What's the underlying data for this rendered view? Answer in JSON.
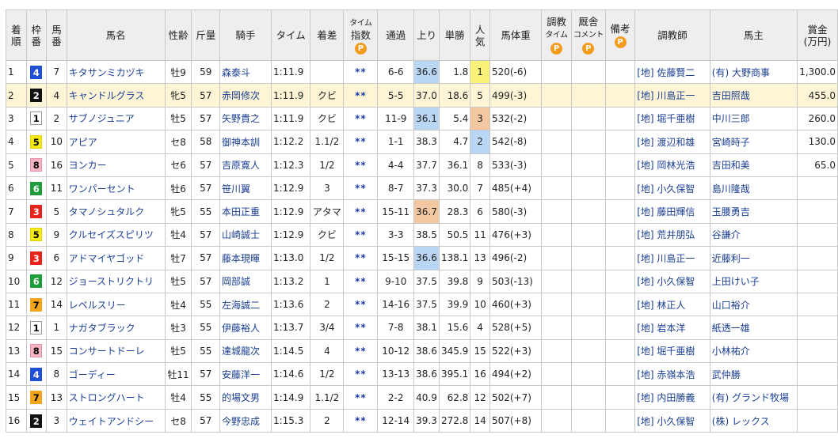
{
  "headers": {
    "finish": [
      "着",
      "順"
    ],
    "waku": [
      "枠",
      "番"
    ],
    "umaban": [
      "馬",
      "番"
    ],
    "horse": "馬名",
    "sex_age": "性齢",
    "weight": "斤量",
    "jockey": "騎手",
    "time": "タイム",
    "margin": "着差",
    "time_index": [
      "タイム",
      "指数"
    ],
    "passing": "通過",
    "last3f": "上り",
    "odds": "単勝",
    "popularity": [
      "人",
      "気"
    ],
    "body_weight": "馬体重",
    "training_time": [
      "調教",
      "タイム"
    ],
    "stable_comment": [
      "厩舎",
      "コメント"
    ],
    "remarks": "備考",
    "trainer": "調教師",
    "owner": "馬主",
    "prize": [
      "賞金",
      "(万円)"
    ]
  },
  "premium_icon_text": "P",
  "waku_colors": {
    "1": {
      "bg": "#ffffff",
      "fg": "#000000",
      "border": "#999999"
    },
    "2": {
      "bg": "#111111",
      "fg": "#ffffff",
      "border": "#111111"
    },
    "3": {
      "bg": "#e8231b",
      "fg": "#ffffff",
      "border": "#e8231b"
    },
    "4": {
      "bg": "#1f4fd6",
      "fg": "#ffffff",
      "border": "#1f4fd6"
    },
    "5": {
      "bg": "#f6ea14",
      "fg": "#000000",
      "border": "#e0d000"
    },
    "6": {
      "bg": "#1f9d3a",
      "fg": "#ffffff",
      "border": "#1f9d3a"
    },
    "7": {
      "bg": "#f5a51a",
      "fg": "#000000",
      "border": "#f5a51a"
    },
    "8": {
      "bg": "#f7b5c4",
      "fg": "#000000",
      "border": "#e592a6"
    }
  },
  "last3f_highlight": {
    "first": "#b9d7f5",
    "second": "#f3c7a2"
  },
  "pop_highlight": {
    "1": "#fbf27a",
    "2": "#b9d7f5",
    "3": "#f3c7a2"
  },
  "rows": [
    {
      "pos": "1",
      "waku": "4",
      "num": "7",
      "horse": "キタサンミカヅキ",
      "sex_age": "牡9",
      "wt": "59",
      "jockey": "森泰斗",
      "time": "1:11.9",
      "margin": "",
      "idx": "**",
      "pass": "6-6",
      "last3f": "36.6",
      "l3rank": "1",
      "odds": "1.8",
      "pop": "1",
      "bw": "520(-6)",
      "trainer": "[地] 佐藤賢二",
      "owner": "(有) 大野商事",
      "prize": "1,300.0"
    },
    {
      "pos": "2",
      "waku": "2",
      "num": "4",
      "horse": "キャンドルグラス",
      "sex_age": "牝5",
      "wt": "57",
      "jockey": "赤岡修次",
      "time": "1:11.9",
      "margin": "クビ",
      "idx": "**",
      "pass": "5-5",
      "last3f": "37.0",
      "l3rank": "",
      "odds": "18.6",
      "pop": "5",
      "bw": "499(-3)",
      "trainer": "[地] 川島正一",
      "owner": "吉田照哉",
      "prize": "455.0",
      "hl": true
    },
    {
      "pos": "3",
      "waku": "1",
      "num": "2",
      "horse": "サブノジュニア",
      "sex_age": "牡5",
      "wt": "57",
      "jockey": "矢野貴之",
      "time": "1:11.9",
      "margin": "クビ",
      "idx": "**",
      "pass": "11-9",
      "last3f": "36.1",
      "l3rank": "1",
      "odds": "5.4",
      "pop": "3",
      "bw": "532(-2)",
      "trainer": "[地] 堀千亜樹",
      "owner": "中川三郎",
      "prize": "260.0"
    },
    {
      "pos": "4",
      "waku": "5",
      "num": "10",
      "horse": "アピア",
      "sex_age": "セ8",
      "wt": "58",
      "jockey": "御神本訓",
      "time": "1:12.2",
      "margin": "1.1/2",
      "idx": "**",
      "pass": "1-1",
      "last3f": "38.3",
      "l3rank": "",
      "odds": "4.7",
      "pop": "2",
      "bw": "542(-8)",
      "trainer": "[地] 渡辺和雄",
      "owner": "宮崎時子",
      "prize": "130.0"
    },
    {
      "pos": "5",
      "waku": "8",
      "num": "16",
      "horse": "ヨンカー",
      "sex_age": "セ6",
      "wt": "57",
      "jockey": "吉原寛人",
      "time": "1:12.3",
      "margin": "1/2",
      "idx": "**",
      "pass": "4-4",
      "last3f": "37.7",
      "l3rank": "",
      "odds": "36.1",
      "pop": "8",
      "bw": "533(-3)",
      "trainer": "[地] 岡林光浩",
      "owner": "吉田和美",
      "prize": "65.0"
    },
    {
      "pos": "6",
      "waku": "6",
      "num": "11",
      "horse": "ワンパーセント",
      "sex_age": "牡6",
      "wt": "57",
      "jockey": "笹川翼",
      "time": "1:12.9",
      "margin": "3",
      "idx": "**",
      "pass": "8-7",
      "last3f": "37.3",
      "l3rank": "",
      "odds": "30.0",
      "pop": "7",
      "bw": "485(+4)",
      "trainer": "[地] 小久保智",
      "owner": "島川隆哉",
      "prize": ""
    },
    {
      "pos": "7",
      "waku": "3",
      "num": "5",
      "horse": "タマノシュタルク",
      "sex_age": "牝5",
      "wt": "55",
      "jockey": "本田正重",
      "time": "1:12.9",
      "margin": "アタマ",
      "idx": "**",
      "pass": "15-11",
      "last3f": "36.7",
      "l3rank": "2",
      "odds": "28.3",
      "pop": "6",
      "bw": "580(-3)",
      "trainer": "[地] 藤田輝信",
      "owner": "玉腰勇吉",
      "prize": ""
    },
    {
      "pos": "8",
      "waku": "5",
      "num": "9",
      "horse": "クルセイズスピリツ",
      "sex_age": "牡4",
      "wt": "57",
      "jockey": "山崎誠士",
      "time": "1:12.9",
      "margin": "クビ",
      "idx": "**",
      "pass": "3-3",
      "last3f": "38.5",
      "l3rank": "",
      "odds": "50.5",
      "pop": "11",
      "bw": "476(+3)",
      "trainer": "[地] 荒井朋弘",
      "owner": "谷謙介",
      "prize": ""
    },
    {
      "pos": "9",
      "waku": "3",
      "num": "6",
      "horse": "アドマイヤゴッド",
      "sex_age": "牡7",
      "wt": "57",
      "jockey": "藤本現暉",
      "time": "1:13.0",
      "margin": "1/2",
      "idx": "**",
      "pass": "15-15",
      "last3f": "36.6",
      "l3rank": "1",
      "odds": "138.1",
      "pop": "13",
      "bw": "496(-2)",
      "trainer": "[地] 川島正一",
      "owner": "近藤利一",
      "prize": ""
    },
    {
      "pos": "10",
      "waku": "6",
      "num": "12",
      "horse": "ジョーストリクトリ",
      "sex_age": "牡5",
      "wt": "57",
      "jockey": "岡部誠",
      "time": "1:13.2",
      "margin": "1",
      "idx": "**",
      "pass": "9-10",
      "last3f": "37.5",
      "l3rank": "",
      "odds": "39.8",
      "pop": "9",
      "bw": "503(-13)",
      "trainer": "[地] 小久保智",
      "owner": "上田けい子",
      "prize": ""
    },
    {
      "pos": "11",
      "waku": "7",
      "num": "14",
      "horse": "レベルスリー",
      "sex_age": "牡4",
      "wt": "55",
      "jockey": "左海誠二",
      "time": "1:13.6",
      "margin": "2",
      "idx": "**",
      "pass": "14-16",
      "last3f": "37.5",
      "l3rank": "",
      "odds": "39.9",
      "pop": "10",
      "bw": "460(+3)",
      "trainer": "[地] 林正人",
      "owner": "山口裕介",
      "prize": ""
    },
    {
      "pos": "12",
      "waku": "1",
      "num": "1",
      "horse": "ナガタブラック",
      "sex_age": "牡3",
      "wt": "55",
      "jockey": "伊藤裕人",
      "time": "1:13.7",
      "margin": "3/4",
      "idx": "**",
      "pass": "7-8",
      "last3f": "38.1",
      "l3rank": "",
      "odds": "15.6",
      "pop": "4",
      "bw": "528(+5)",
      "trainer": "[地] 岩本洋",
      "owner": "紙透一雄",
      "prize": ""
    },
    {
      "pos": "13",
      "waku": "8",
      "num": "15",
      "horse": "コンサートドーレ",
      "sex_age": "牡5",
      "wt": "55",
      "jockey": "達城龍次",
      "time": "1:14.5",
      "margin": "4",
      "idx": "**",
      "pass": "10-12",
      "last3f": "38.6",
      "l3rank": "",
      "odds": "345.9",
      "pop": "15",
      "bw": "522(+3)",
      "trainer": "[地] 堀千亜樹",
      "owner": "小林祐介",
      "prize": ""
    },
    {
      "pos": "14",
      "waku": "4",
      "num": "8",
      "horse": "ゴーディー",
      "sex_age": "牡11",
      "wt": "57",
      "jockey": "安藤洋一",
      "time": "1:14.6",
      "margin": "1/2",
      "idx": "**",
      "pass": "13-13",
      "last3f": "38.6",
      "l3rank": "",
      "odds": "395.1",
      "pop": "16",
      "bw": "494(+2)",
      "trainer": "[地] 赤嶺本浩",
      "owner": "武仲勝",
      "prize": ""
    },
    {
      "pos": "15",
      "waku": "7",
      "num": "13",
      "horse": "ストロングハート",
      "sex_age": "牡4",
      "wt": "55",
      "jockey": "的場文男",
      "time": "1:14.9",
      "margin": "1.1/2",
      "idx": "**",
      "pass": "2-2",
      "last3f": "40.9",
      "l3rank": "",
      "odds": "62.8",
      "pop": "12",
      "bw": "502(+7)",
      "trainer": "[地] 内田勝義",
      "owner": "(有) グランド牧場",
      "prize": ""
    },
    {
      "pos": "16",
      "waku": "2",
      "num": "3",
      "horse": "ウェイトアンドシー",
      "sex_age": "セ8",
      "wt": "57",
      "jockey": "今野忠成",
      "time": "1:15.3",
      "margin": "2",
      "idx": "**",
      "pass": "12-14",
      "last3f": "39.3",
      "l3rank": "",
      "odds": "272.8",
      "pop": "14",
      "bw": "507(+8)",
      "trainer": "[地] 小久保智",
      "owner": "(株) レックス",
      "prize": ""
    }
  ]
}
